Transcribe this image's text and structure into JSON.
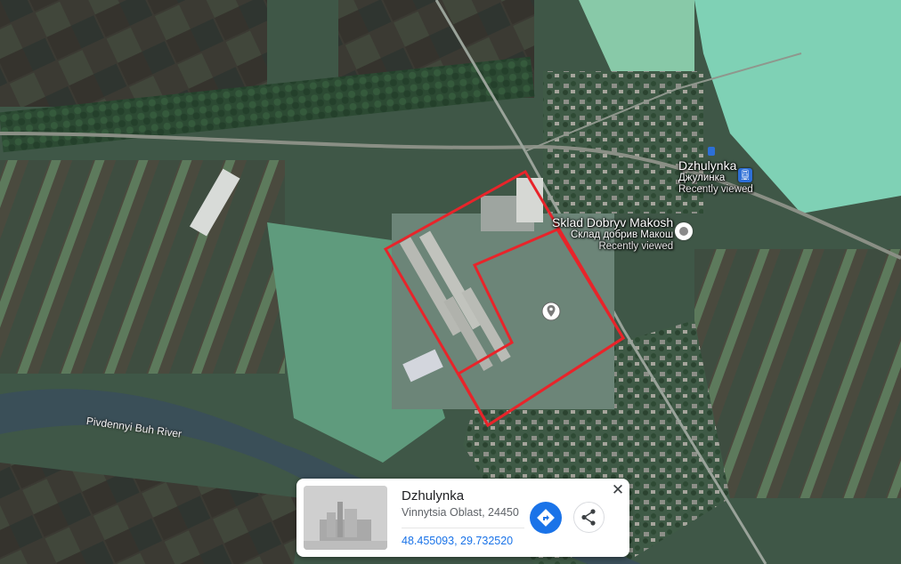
{
  "map": {
    "type": "satellite",
    "river_label": "Pivdennyi Buh River",
    "highlight_color": "#e8242a"
  },
  "markers": {
    "town": {
      "name": "Dzhulynka",
      "local_name": "Джулинка",
      "status": "Recently viewed",
      "icon": "train-icon"
    },
    "warehouse": {
      "name": "Sklad Dobryv Makosh",
      "local_name": "Склад добрив Макош",
      "status": "Recently viewed",
      "icon": "place-circle-icon"
    },
    "dropped_pin": {
      "icon": "map-pin-icon"
    }
  },
  "info_card": {
    "title": "Dzhulynka",
    "address": "Vinnytsia Oblast, 24450",
    "coordinates": "48.455093, 29.732520",
    "close_label": "✕",
    "directions_icon": "directions-icon",
    "share_icon": "share-icon",
    "accent_color": "#1a73e8"
  }
}
